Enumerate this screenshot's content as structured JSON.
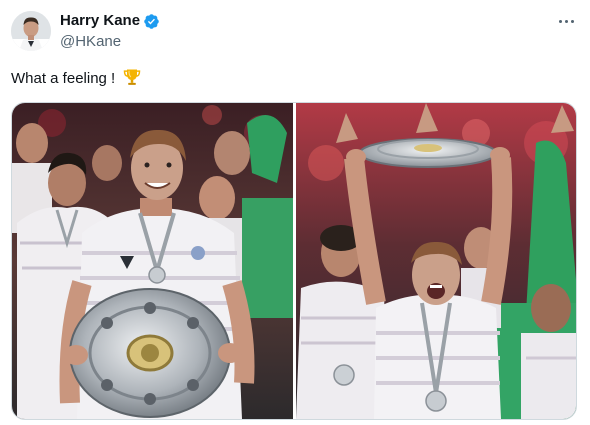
{
  "author": {
    "name": "Harry Kane",
    "handle": "@HKane",
    "verified": true
  },
  "post": {
    "text": "What a feeling !",
    "emoji": "trophy-icon"
  },
  "media": {
    "count": 2,
    "photos": [
      {
        "name": "photo-holding-meisterschale"
      },
      {
        "name": "photo-lifting-meisterschale"
      }
    ]
  },
  "colors": {
    "verified": "#1d9bf0",
    "text": "#0f1419",
    "secondary": "#536471",
    "border": "#cfd9de"
  }
}
